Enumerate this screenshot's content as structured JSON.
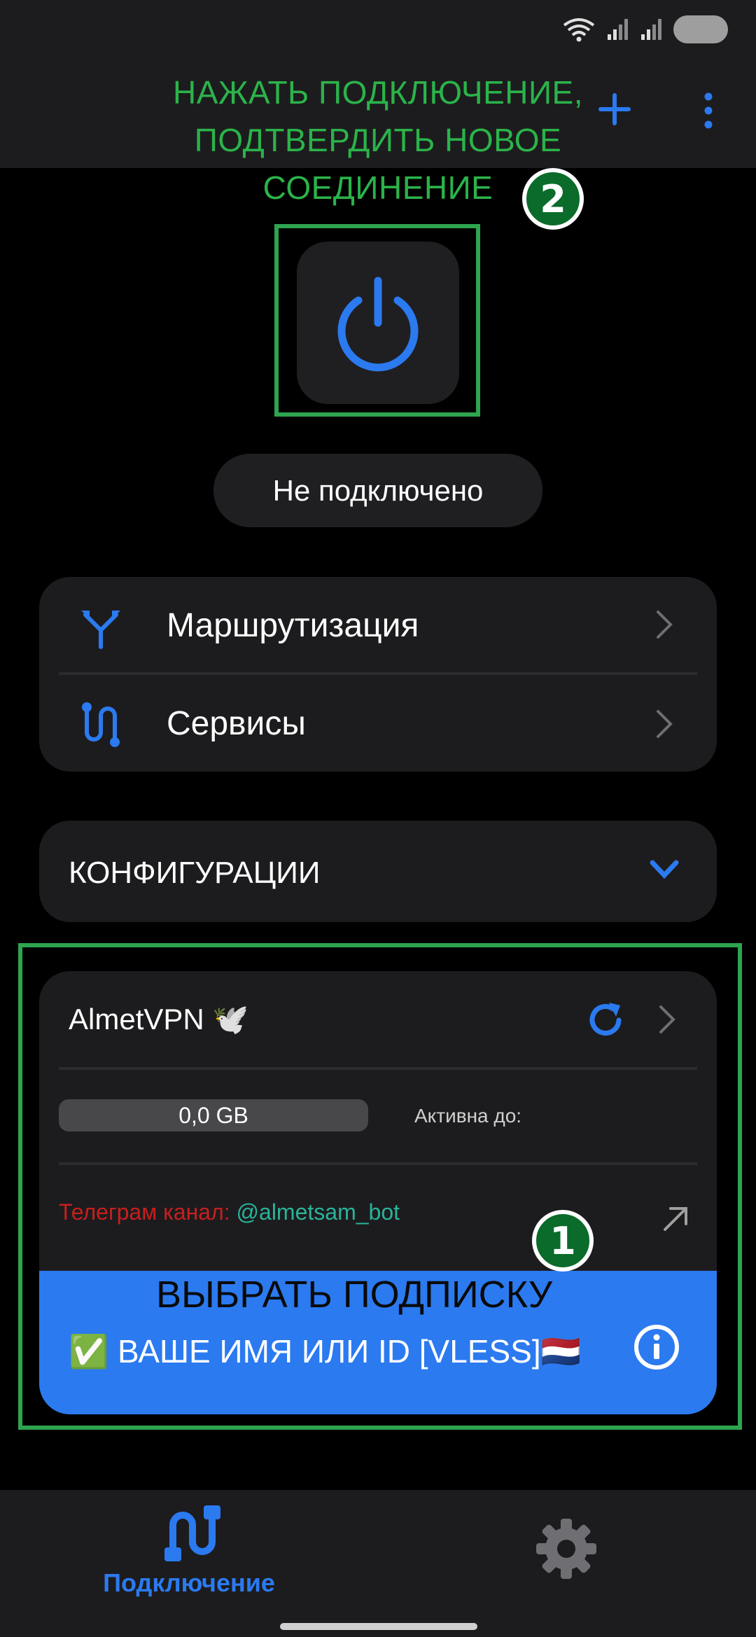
{
  "top_bar": {
    "annotation": "НАЖАТЬ ПОДКЛЮЧЕНИЕ, ПОДТВЕРДИТЬ НОВОЕ СОЕДИНЕНИЕ",
    "add_icon": "plus-icon",
    "more_icon": "more-vertical-icon"
  },
  "steps": {
    "step1": "1",
    "step2": "2"
  },
  "power": {
    "icon": "power-icon",
    "status": "Не подключено"
  },
  "menu": {
    "items": [
      {
        "label": "Маршрутизация",
        "icon": "routing-icon"
      },
      {
        "label": "Сервисы",
        "icon": "services-icon"
      }
    ]
  },
  "configs": {
    "title": "КОНФИГУРАЦИИ"
  },
  "subscription": {
    "name": "AlmetVPN 🕊️",
    "usage": "0,0 GB",
    "usage_fraction": 0,
    "active_until_label": "Активна до:",
    "channel_label": "Телеграм канал:",
    "channel_handle": "@almetsam_bot",
    "annotation": "ВЫБРАТЬ ПОДПИСКУ",
    "selected_config": "✅ ВАШЕ ИМЯ ИЛИ ID [VLESS]🇳🇱"
  },
  "bottom_nav": {
    "connection_label": "Подключение",
    "settings_icon": "gear-icon"
  },
  "colors": {
    "accent": "#2b7af0",
    "annotation_green": "#2bb34a",
    "channel_red": "#c81e1e",
    "handle_teal": "#2ab39a"
  }
}
